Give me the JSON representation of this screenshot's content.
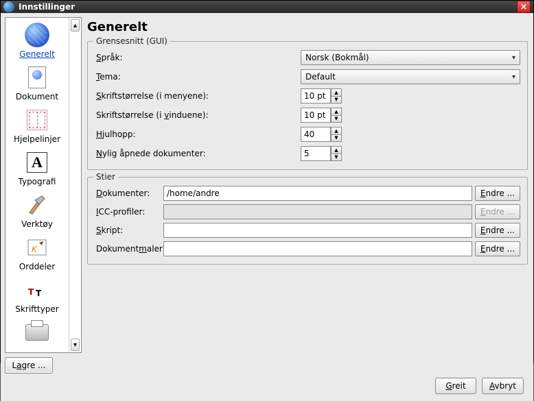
{
  "window": {
    "title": "Innstillinger",
    "close_symbol": "×"
  },
  "sidebar": {
    "items": [
      {
        "label": "Generelt",
        "icon": "globe",
        "selected": true
      },
      {
        "label": "Dokument",
        "icon": "doc"
      },
      {
        "label": "Hjelpelinjer",
        "icon": "guides"
      },
      {
        "label": "Typografi",
        "icon": "typo"
      },
      {
        "label": "Verktøy",
        "icon": "hammer"
      },
      {
        "label": "Orddeler",
        "icon": "k"
      },
      {
        "label": "Skrifttyper",
        "icon": "fonts"
      },
      {
        "label": "",
        "icon": "printer"
      }
    ],
    "up": "▴",
    "down": "▾",
    "save_label_pre": "L",
    "save_label_u": "a",
    "save_label_post": "gre ..."
  },
  "page": {
    "title": "Generelt"
  },
  "gui": {
    "legend": "Grensesnitt (GUI)",
    "language": {
      "label_u": "S",
      "label_post": "pråk:",
      "value": "Norsk (Bokmål)"
    },
    "theme": {
      "label_u": "T",
      "label_post": "ema:",
      "value": "Default"
    },
    "menu_font": {
      "label_u": "S",
      "label_post": "kriftstørrelse (i menyene):",
      "value": "10 pt"
    },
    "window_font": {
      "label_pre": "Skriftstørrelse (i ",
      "label_u": "v",
      "label_post": "induene):",
      "value": "10 pt"
    },
    "wheel": {
      "label_u": "H",
      "label_post": "julhopp:",
      "value": "40"
    },
    "recent": {
      "label_u": "N",
      "label_post": "ylig åpnede dokumenter:",
      "value": "5"
    }
  },
  "paths": {
    "legend": "Stier",
    "docs": {
      "label_u": "D",
      "label_post": "okumenter:",
      "value": "/home/andre"
    },
    "icc": {
      "label_u": "I",
      "label_post": "CC-profiler:",
      "value": ""
    },
    "scripts": {
      "label_u": "S",
      "label_post": "kript:",
      "value": ""
    },
    "templates": {
      "label_pre": "Dokument",
      "label_u": "m",
      "label_post": "aler:",
      "value": ""
    },
    "change_label_u": "E",
    "change_label_post": "ndre ...",
    "change_disabled_u": "E",
    "change_disabled_post": "ndre ..."
  },
  "footer": {
    "ok_u": "G",
    "ok_post": "reit",
    "cancel_u": "A",
    "cancel_post": "vbryt"
  }
}
